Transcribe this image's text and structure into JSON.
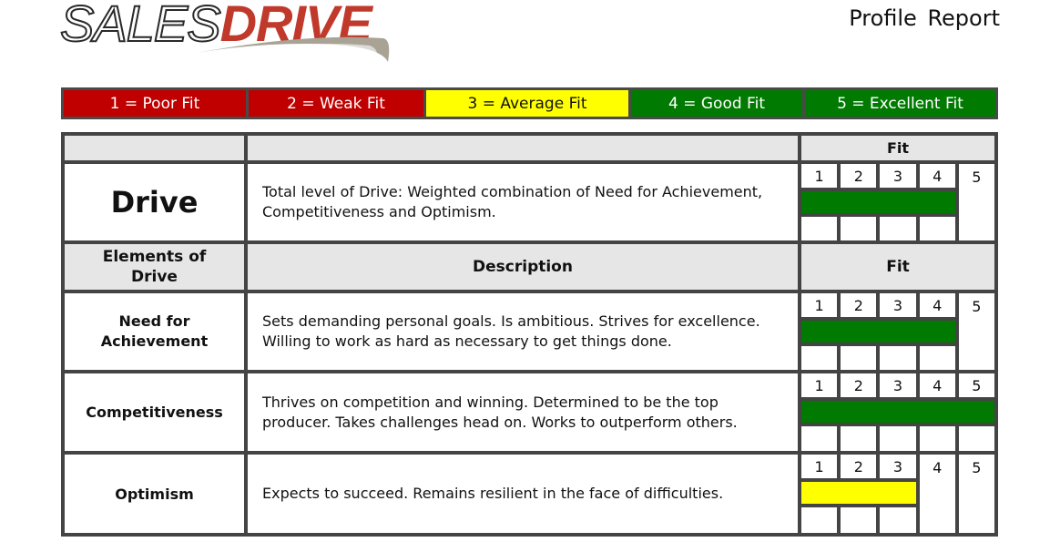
{
  "header": {
    "logo_part1": "SALES",
    "logo_part2": "DRIVE",
    "report_title": "Profile Report"
  },
  "legend": [
    {
      "label": "1 = Poor Fit",
      "color": "#c00000"
    },
    {
      "label": "2 = Weak Fit",
      "color": "#c00000"
    },
    {
      "label": "3 = Average Fit",
      "color": "#ffff00"
    },
    {
      "label": "4 = Good Fit",
      "color": "#007a00"
    },
    {
      "label": "5 = Excellent Fit",
      "color": "#007a00"
    }
  ],
  "table": {
    "top_header": {
      "col1": "",
      "col2": "",
      "fit": "Fit"
    },
    "scale": [
      "1",
      "2",
      "3",
      "4",
      "5"
    ],
    "drive": {
      "name": "Drive",
      "description": "Total level of Drive: Weighted combination of Need for Achievement, Competitiveness and Optimism.",
      "score": 4,
      "bar_color": "#007a00"
    },
    "elements_header": {
      "col1": "Elements of Drive",
      "col2": "Description",
      "fit": "Fit"
    },
    "elements": [
      {
        "name": "Need for Achievement",
        "description": "Sets demanding personal goals. Is ambitious. Strives for excellence. Willing to work as hard as necessary to get things done.",
        "score": 4,
        "bar_color": "#007a00"
      },
      {
        "name": "Competitiveness",
        "description": "Thrives on competition and winning. Determined to be the top producer. Takes challenges head on. Works to outperform others.",
        "score": 5,
        "bar_color": "#007a00"
      },
      {
        "name": "Optimism",
        "description": "Expects to succeed. Remains resilient in the face of difficulties.",
        "score": 3,
        "bar_color": "#ffff00"
      }
    ]
  }
}
